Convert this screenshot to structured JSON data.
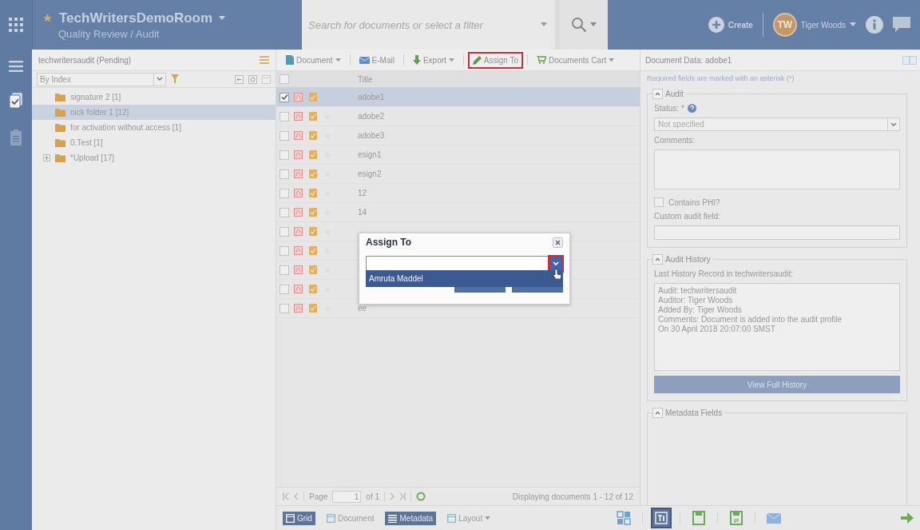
{
  "header": {
    "app_title": "TechWritersDemoRoom",
    "subtitle": "Quality Review / Audit",
    "search": {
      "placeholder": "Search for documents or select a filter"
    },
    "create": "Create",
    "user": {
      "initials": "TW",
      "name": "Tiger Woods"
    }
  },
  "left_panel": {
    "title": "techwritersaudit (Pending)",
    "index_select": "By Index",
    "tree": [
      {
        "label": "signature 2 [1]",
        "selected": false,
        "kind": "leaf"
      },
      {
        "label": "nick folder 1 [12]",
        "selected": true,
        "kind": "leaf"
      },
      {
        "label": "for activation without access [1]",
        "selected": false,
        "kind": "leaf"
      },
      {
        "label": "0.Test [1]",
        "selected": false,
        "kind": "leaf"
      },
      {
        "label": "*Upload [17]",
        "selected": false,
        "kind": "branch",
        "expanded": false
      }
    ]
  },
  "toolbar": [
    {
      "label": "Document",
      "dropdown": true,
      "highlighted": false
    },
    {
      "label": "E-Mail",
      "dropdown": false,
      "highlighted": false
    },
    {
      "label": "Export",
      "dropdown": true,
      "highlighted": false
    },
    {
      "label": "Assign To",
      "dropdown": false,
      "highlighted": true
    },
    {
      "label": "Documents Cart",
      "dropdown": true,
      "highlighted": false
    }
  ],
  "grid": {
    "columns": [
      "Title"
    ],
    "select_all_checked": false,
    "rows": [
      {
        "title": "adobe1",
        "checked": true,
        "selected": true,
        "star": false
      },
      {
        "title": "adobe2",
        "checked": false,
        "selected": false,
        "star": true
      },
      {
        "title": "adobe3",
        "checked": false,
        "selected": false,
        "star": true
      },
      {
        "title": "esign1",
        "checked": false,
        "selected": false,
        "star": true
      },
      {
        "title": "esign2",
        "checked": false,
        "selected": false,
        "star": true
      },
      {
        "title": "12",
        "checked": false,
        "selected": false,
        "star": true
      },
      {
        "title": "14",
        "checked": false,
        "selected": false,
        "star": true
      },
      {
        "checked": false,
        "selected": false,
        "star": true
      },
      {
        "checked": false,
        "selected": false,
        "star": true
      },
      {
        "checked": false,
        "selected": false,
        "star": true
      },
      {
        "checked": false,
        "selected": false,
        "star": true
      },
      {
        "title": "ee",
        "checked": false,
        "selected": false,
        "star": true
      }
    ]
  },
  "pager": {
    "page_label": "Page",
    "page": "1",
    "of": "of 1",
    "summary": "Displaying documents 1 - 12 of 12"
  },
  "bottom_bar": {
    "views": [
      {
        "label": "Grid",
        "selected": true
      },
      {
        "label": "Document",
        "selected": false
      },
      {
        "label": "Metadata",
        "selected": true
      },
      {
        "label": "Layout",
        "selected": false
      }
    ],
    "tools": [
      {
        "selected": false
      },
      {
        "selected": true
      },
      {
        "selected": false
      },
      {
        "selected": false
      },
      {
        "selected": false
      }
    ]
  },
  "right_panel": {
    "title": "Document Data: adobe1",
    "note": "Required fields are marked with an asterisk (*)",
    "audit": {
      "legend": "Audit",
      "status_label": "Status:",
      "required_mark": "*",
      "status_placeholder": "Not specified",
      "comments_label": "Comments:",
      "phi": {
        "label": "Contains PHI?",
        "checked": false
      },
      "custom_label": "Custom audit field:"
    },
    "history": {
      "legend": "Audit History",
      "label": "Last History Record in techwritersaudit:",
      "lines": [
        "Audit: techwritersaudit",
        "Auditor: Tiger Woods",
        "Added By: Tiger Woods",
        "Comments: Document is added into the audit profile",
        "On 30 April 2018 20:07:00 SMST"
      ],
      "button": "View Full History"
    },
    "metadata": {
      "legend": "Metadata Fields"
    }
  },
  "dialog": {
    "title": "Assign To",
    "options": [
      "Amruta Maddel"
    ],
    "dropdown_highlighted": true
  }
}
